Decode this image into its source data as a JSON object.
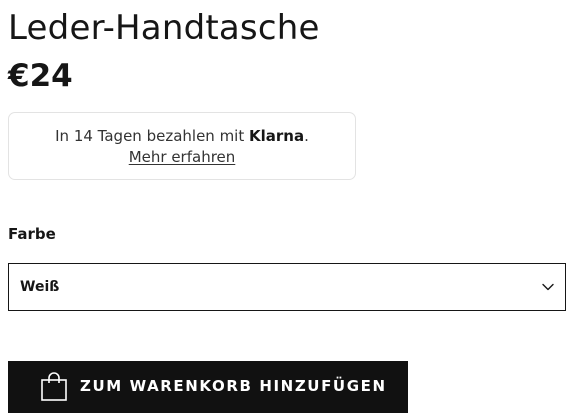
{
  "product": {
    "title": "Leder-Handtasche",
    "price": "€24"
  },
  "klarna": {
    "text_before": "In 14 Tagen bezahlen mit ",
    "brand": "Klarna",
    "text_after": ".",
    "link": "Mehr erfahren"
  },
  "color": {
    "label": "Farbe",
    "selected": "Weiß",
    "icon": "chevron-down-icon"
  },
  "cart": {
    "button_label": "ZUM WARENKORB HINZUFÜGEN",
    "icon": "shopping-bag-icon"
  },
  "colors": {
    "text": "#161616",
    "button_background": "#111111",
    "button_text": "#ffffff",
    "box_border": "#e3e3e3"
  }
}
